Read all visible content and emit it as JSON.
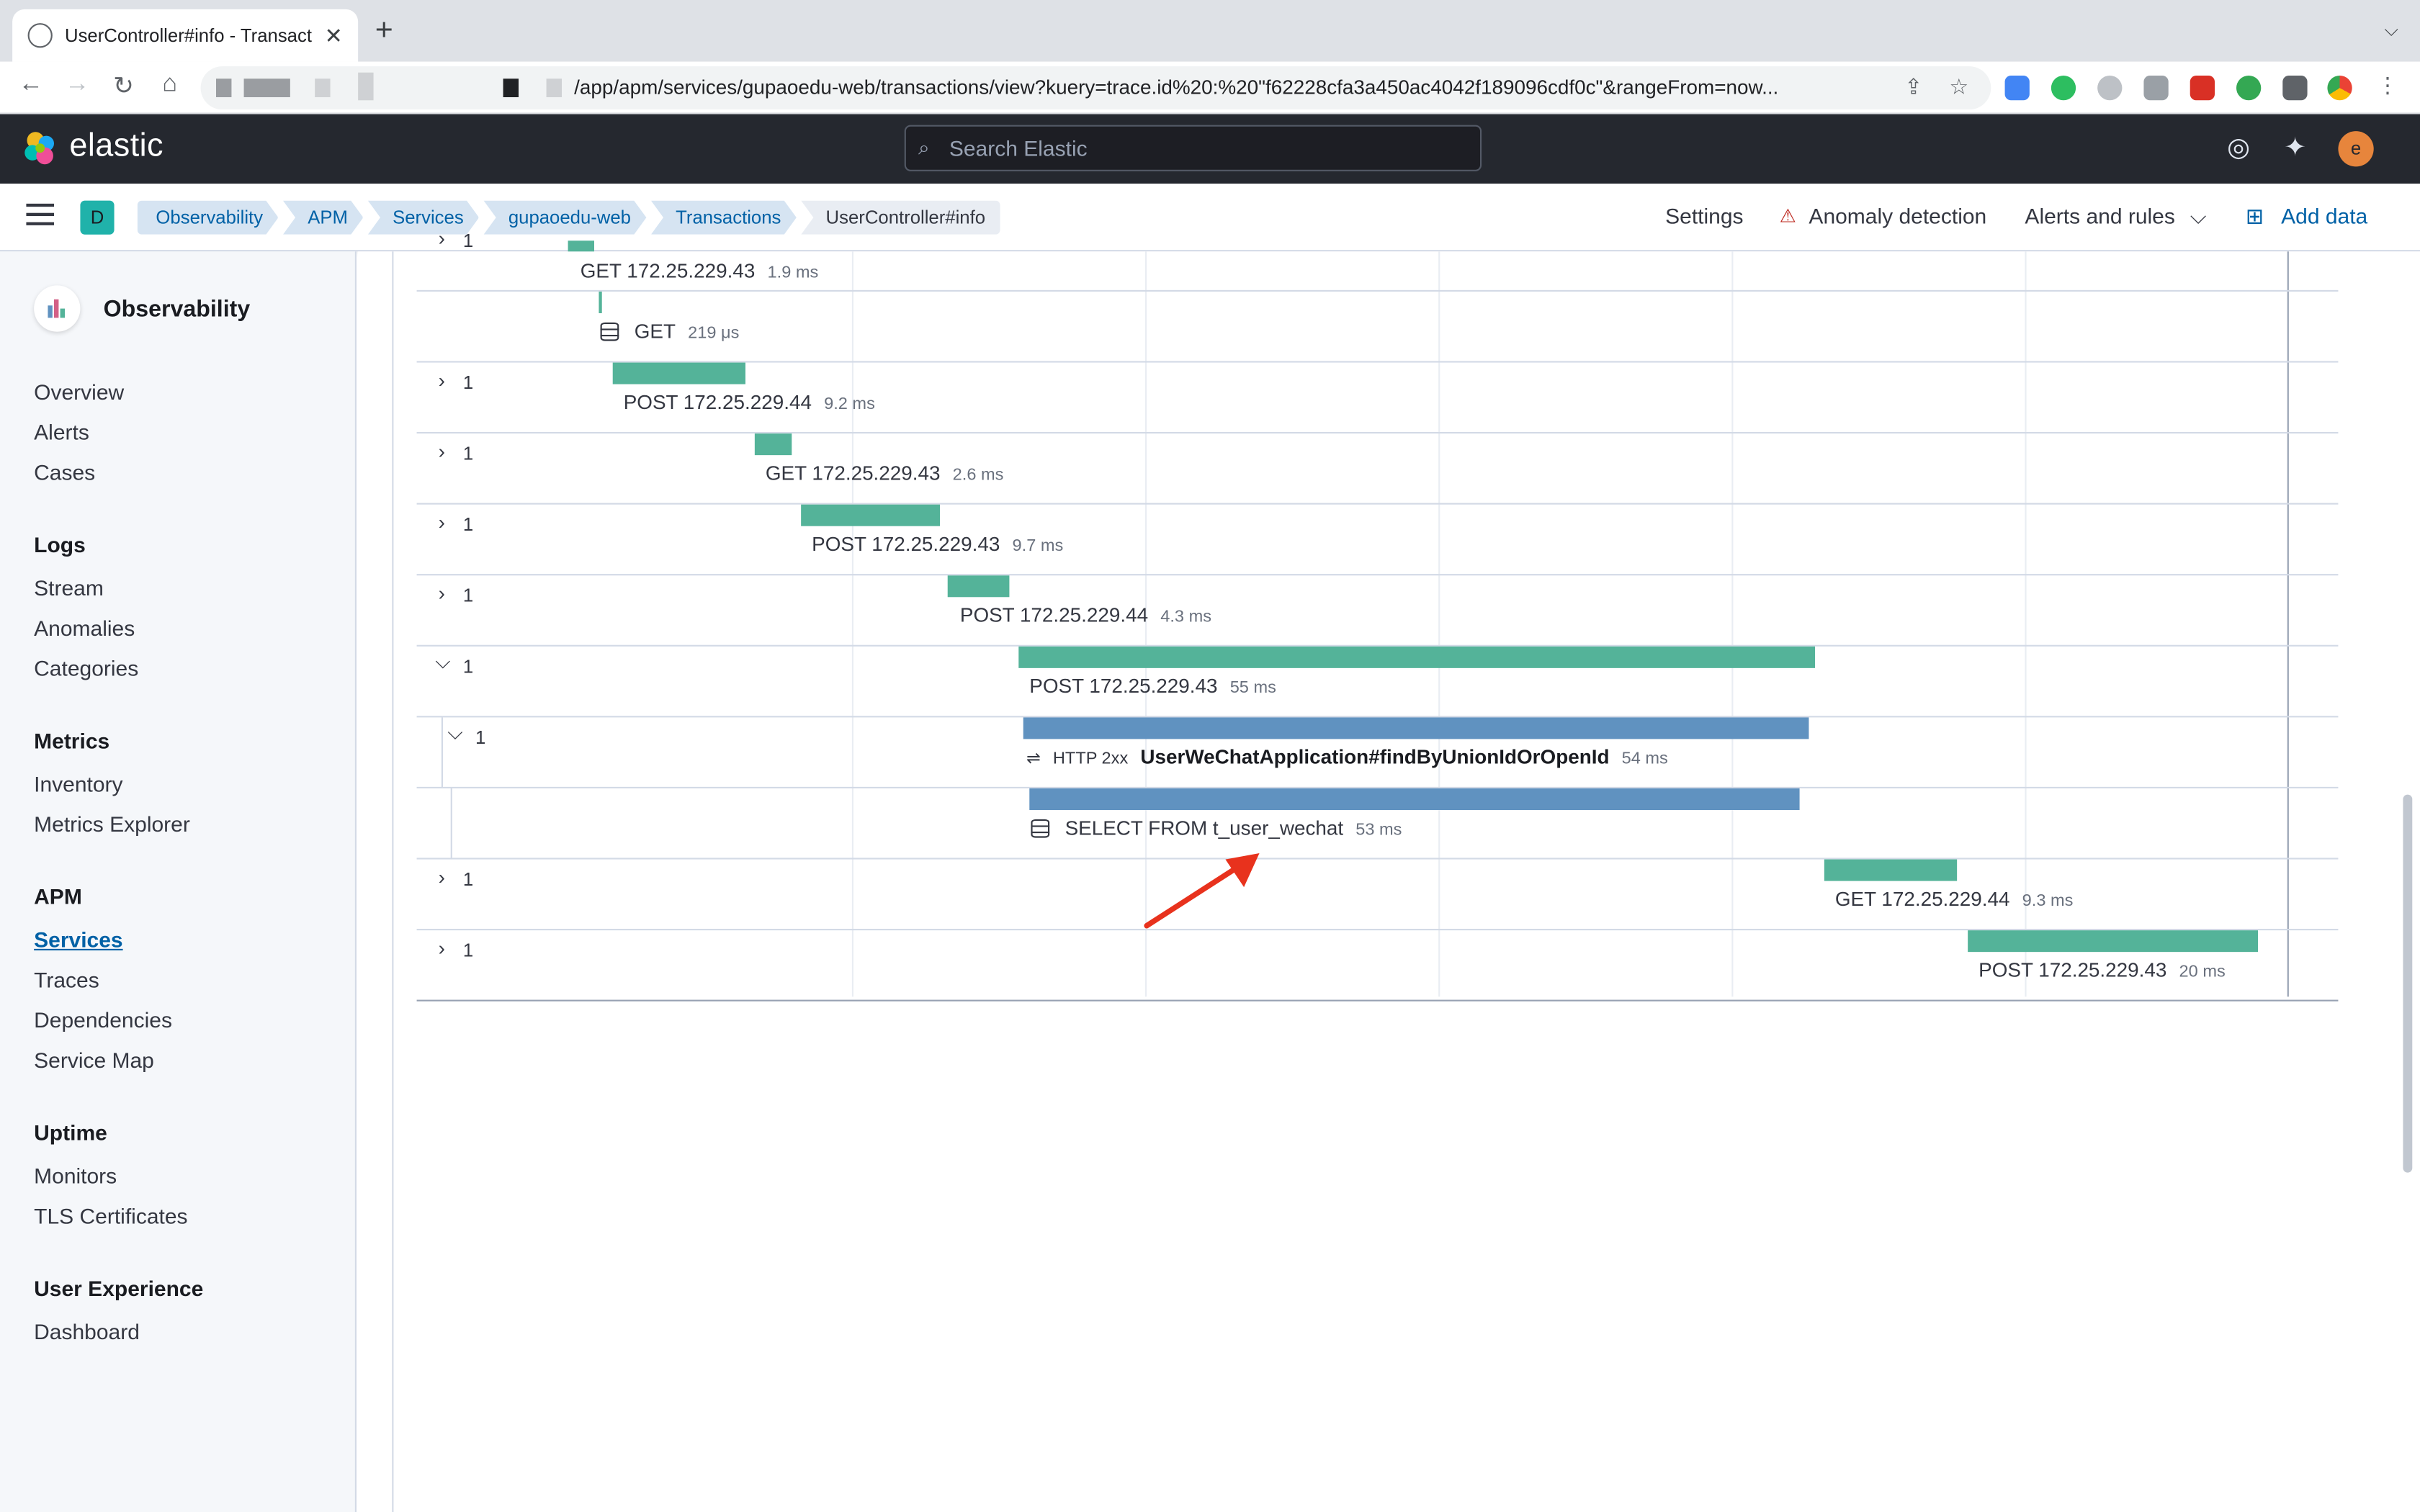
{
  "browser": {
    "tab_title": "UserController#info - Transacti",
    "tab_close": "✕",
    "new_tab": "+",
    "url": "/app/apm/services/gupaoedu-web/transactions/view?kuery=trace.id%20:%20\"f62228cfa3a450ac4042f189096cdf0c\"&rangeFrom=now..."
  },
  "header": {
    "brand": "elastic",
    "search_placeholder": "Search Elastic",
    "avatar_initial": "e"
  },
  "breadcrumb": {
    "space_initial": "D",
    "items": [
      "Observability",
      "APM",
      "Services",
      "gupaoedu-web",
      "Transactions",
      "UserController#info"
    ]
  },
  "header_links": {
    "settings": "Settings",
    "anomaly": "Anomaly detection",
    "alerts": "Alerts and rules",
    "add_data": "Add data"
  },
  "sidebar": {
    "title": "Observability",
    "top": [
      "Overview",
      "Alerts",
      "Cases"
    ],
    "sections": [
      {
        "heading": "Logs",
        "items": [
          "Stream",
          "Anomalies",
          "Categories"
        ]
      },
      {
        "heading": "Metrics",
        "items": [
          "Inventory",
          "Metrics Explorer"
        ]
      },
      {
        "heading": "APM",
        "items": [
          "Services",
          "Traces",
          "Dependencies",
          "Service Map"
        ]
      },
      {
        "heading": "Uptime",
        "items": [
          "Monitors",
          "TLS Certificates"
        ]
      },
      {
        "heading": "User Experience",
        "items": [
          "Dashboard"
        ]
      }
    ],
    "active": "Services"
  },
  "waterfall": [
    {
      "count": "1",
      "label": "GET 172.25.229.43",
      "duration": "1.9 ms"
    },
    {
      "count": "",
      "label": "GET",
      "duration": "219 μs"
    },
    {
      "count": "1",
      "label": "POST 172.25.229.44",
      "duration": "9.2 ms"
    },
    {
      "count": "1",
      "label": "GET 172.25.229.43",
      "duration": "2.6 ms"
    },
    {
      "count": "1",
      "label": "POST 172.25.229.43",
      "duration": "9.7 ms"
    },
    {
      "count": "1",
      "label": "POST 172.25.229.44",
      "duration": "4.3 ms"
    },
    {
      "count": "1",
      "label": "POST 172.25.229.43",
      "duration": "55 ms"
    },
    {
      "count": "1",
      "status": "HTTP 2xx",
      "label": "UserWeChatApplication#findByUnionIdOrOpenId",
      "duration": "54 ms"
    },
    {
      "count": "",
      "label": "SELECT FROM t_user_wechat",
      "duration": "53 ms"
    },
    {
      "count": "1",
      "label": "GET 172.25.229.44",
      "duration": "9.3 ms"
    },
    {
      "count": "1",
      "label": "POST 172.25.229.43",
      "duration": "20 ms"
    }
  ],
  "colors": {
    "transaction_bar": "#54b399",
    "span_bar": "#6092c0",
    "header_bg": "#25282f",
    "annotation_arrow": "#e8321d"
  },
  "icons": [
    "search-icon",
    "help-icon",
    "news-icon",
    "warning-icon",
    "add-data-icon",
    "chevron-down-icon",
    "database-icon",
    "http-exchange-icon"
  ]
}
